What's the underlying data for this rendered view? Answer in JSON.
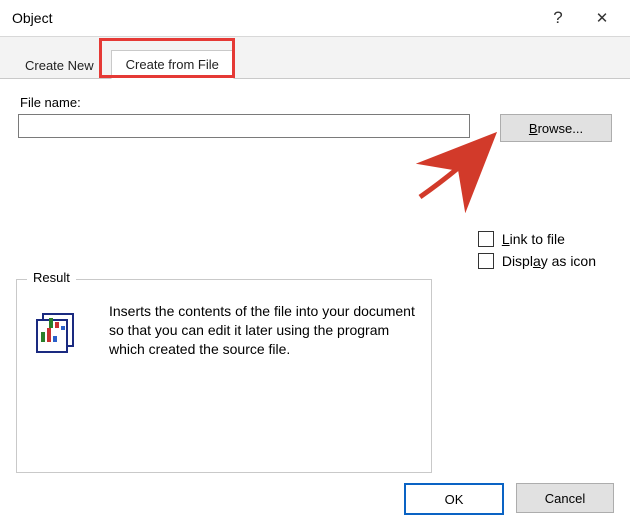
{
  "window": {
    "title": "Object",
    "help_glyph": "?",
    "close_glyph": "✕"
  },
  "tabs": {
    "create_new": "Create New",
    "create_from_file": "Create from File"
  },
  "file": {
    "label": "File name:",
    "value": "",
    "browse_prefix": "B",
    "browse_rest": "rowse..."
  },
  "options": {
    "link_prefix": "L",
    "link_rest": "ink to file",
    "icon_prefix": "Displ",
    "icon_underline": "a",
    "icon_rest": "y as icon"
  },
  "result": {
    "legend": "Result",
    "description": "Inserts the contents of the file into your document so that you can edit it later using the program which created the source file."
  },
  "buttons": {
    "ok": "OK",
    "cancel": "Cancel"
  }
}
